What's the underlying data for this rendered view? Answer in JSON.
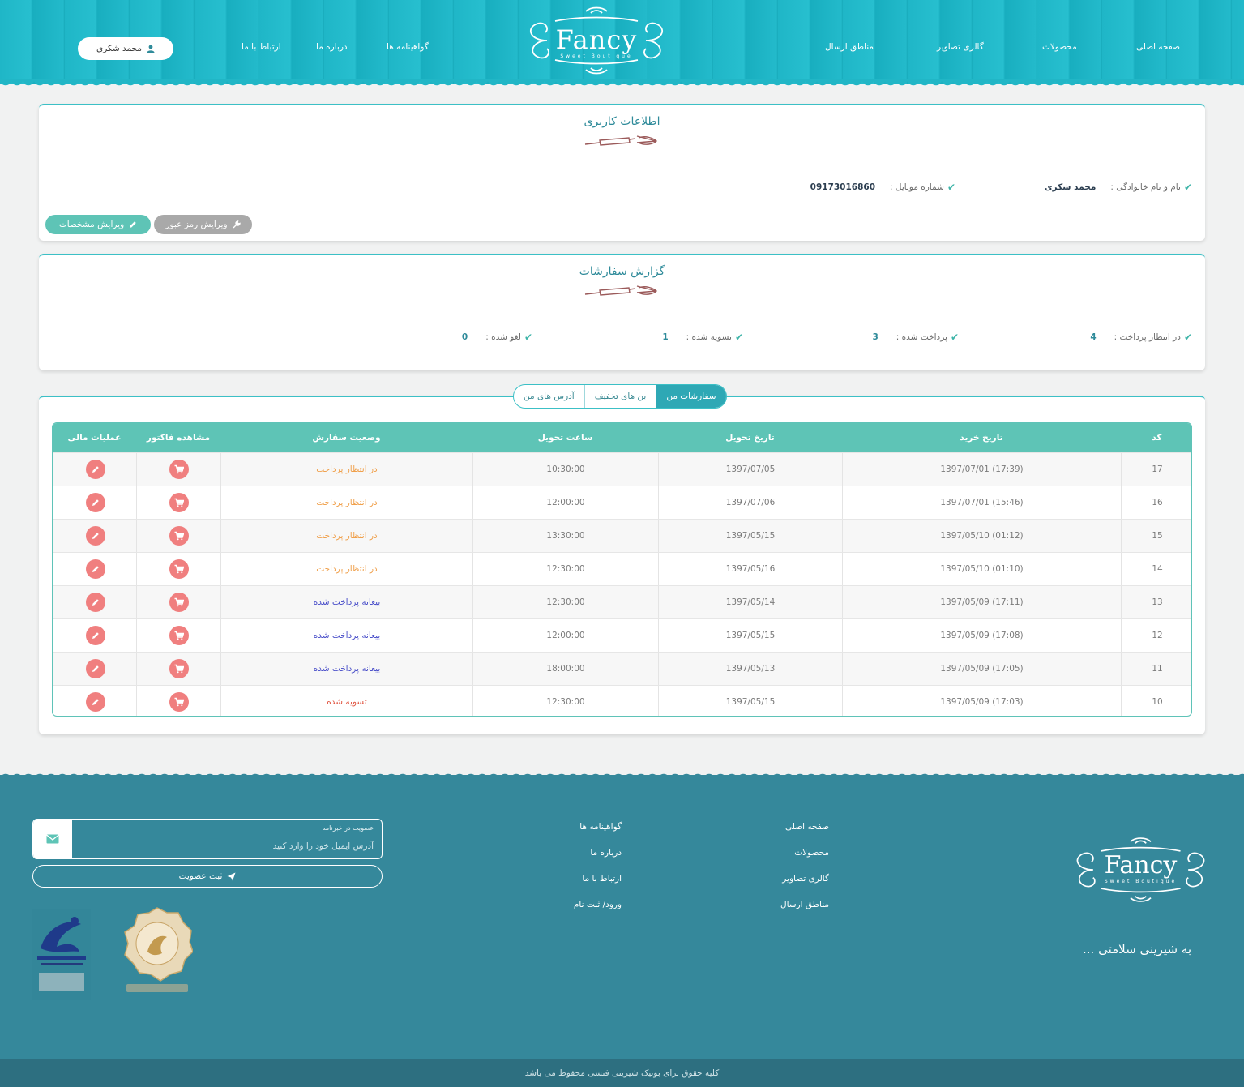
{
  "header": {
    "brand": "Fancy",
    "brand_sub": "Sweet Boutique",
    "nav": [
      "صفحه اصلی",
      "محصولات",
      "گالری تصاویر",
      "مناطق ارسال",
      "گواهینامه ها",
      "درباره ما",
      "ارتباط با ما"
    ],
    "user_name": "محمد شکری"
  },
  "user_info": {
    "title": "اطلاعات کاربری",
    "name_label": "نام و نام خانوادگی :",
    "name_value": "محمد شکری",
    "mobile_label": "شماره موبایل :",
    "mobile_value": "09173016860",
    "edit_profile_label": "ویرایش مشخصات",
    "edit_password_label": "ویرایش رمز عبور"
  },
  "orders_report": {
    "title": "گزارش سفارشات",
    "items": [
      {
        "label": "در انتظار پرداخت :",
        "value": "4"
      },
      {
        "label": "پرداخت شده :",
        "value": "3"
      },
      {
        "label": "تسویه شده :",
        "value": "1"
      },
      {
        "label": "لغو شده :",
        "value": "0"
      }
    ]
  },
  "tabs": [
    "سفارشات من",
    "بن های تخفیف",
    "آدرس های من"
  ],
  "table": {
    "headers": [
      "کد",
      "تاریخ خرید",
      "تاریخ تحویل",
      "ساعت تحویل",
      "وضعیت سفارش",
      "مشاهده فاکتور",
      "عملیات مالی"
    ],
    "rows": [
      {
        "code": "17",
        "purchase": "1397/07/01 (17:39)",
        "delivery": "1397/07/05",
        "time": "10:30:00",
        "status": "در انتظار پرداخت",
        "status_color": "#f0a04b"
      },
      {
        "code": "16",
        "purchase": "1397/07/01 (15:46)",
        "delivery": "1397/07/06",
        "time": "12:00:00",
        "status": "در انتظار پرداخت",
        "status_color": "#f0a04b"
      },
      {
        "code": "15",
        "purchase": "1397/05/10 (01:12)",
        "delivery": "1397/05/15",
        "time": "13:30:00",
        "status": "در انتظار پرداخت",
        "status_color": "#f0a04b"
      },
      {
        "code": "14",
        "purchase": "1397/05/10 (01:10)",
        "delivery": "1397/05/16",
        "time": "12:30:00",
        "status": "در انتظار پرداخت",
        "status_color": "#f0a04b"
      },
      {
        "code": "13",
        "purchase": "1397/05/09 (17:11)",
        "delivery": "1397/05/14",
        "time": "12:30:00",
        "status": "بیعانه پرداخت شده",
        "status_color": "#4a4fc9"
      },
      {
        "code": "12",
        "purchase": "1397/05/09 (17:08)",
        "delivery": "1397/05/15",
        "time": "12:00:00",
        "status": "بیعانه پرداخت شده",
        "status_color": "#4a4fc9"
      },
      {
        "code": "11",
        "purchase": "1397/05/09 (17:05)",
        "delivery": "1397/05/13",
        "time": "18:00:00",
        "status": "بیعانه پرداخت شده",
        "status_color": "#4a4fc9"
      },
      {
        "code": "10",
        "purchase": "1397/05/09 (17:03)",
        "delivery": "1397/05/15",
        "time": "12:30:00",
        "status": "تسویه شده",
        "status_color": "#e0533f"
      }
    ]
  },
  "footer": {
    "links_col1": [
      "صفحه اصلی",
      "محصولات",
      "گالری تصاویر",
      "مناطق ارسال"
    ],
    "links_col2": [
      "گواهینامه ها",
      "درباره ما",
      "ارتباط با ما",
      "ورود/ ثبت نام"
    ],
    "tagline": "به شیرینی سلامتی ...",
    "newsletter_label": "عضویت در خبرنامه",
    "newsletter_placeholder": "آدرس ایمیل خود را وارد کنید",
    "subscribe_label": "ثبت عضویت",
    "copyright": "کلیه حقوق برای بوتیک شیرینی فنسی محفوظ می باشد",
    "colors": {
      "footer_bg": "#35889b",
      "header_bg": "#1fb6c7",
      "accent": "#5ec4b6"
    }
  }
}
